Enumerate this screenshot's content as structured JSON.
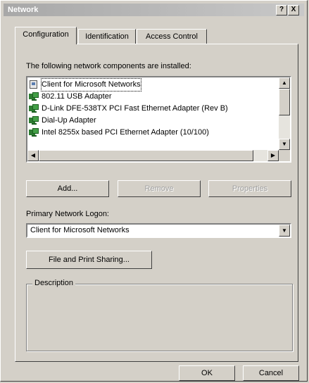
{
  "window": {
    "title": "Network",
    "help_button": "?",
    "close_button": "X"
  },
  "tabs": [
    {
      "label": "Configuration",
      "active": true
    },
    {
      "label": "Identification",
      "active": false
    },
    {
      "label": "Access Control",
      "active": false
    }
  ],
  "components": {
    "heading": "The following network components are installed:",
    "items": [
      {
        "label": "Client for Microsoft Networks",
        "icon": "client-icon"
      },
      {
        "label": "802.11 USB Adapter",
        "icon": "network-adapter-icon"
      },
      {
        "label": "D-Link DFE-538TX PCI Fast Ethernet Adapter (Rev B)",
        "icon": "network-adapter-icon"
      },
      {
        "label": "Dial-Up Adapter",
        "icon": "network-adapter-icon"
      },
      {
        "label": "Intel 8255x based PCI Ethernet Adapter (10/100)",
        "icon": "network-adapter-icon"
      }
    ]
  },
  "buttons": {
    "add": "Add...",
    "remove": "Remove",
    "properties": "Properties"
  },
  "logon": {
    "label": "Primary Network Logon:",
    "value": "Client for Microsoft Networks"
  },
  "sharing_button": "File and Print Sharing...",
  "description": {
    "title": "Description",
    "text": ""
  },
  "footer": {
    "ok": "OK",
    "cancel": "Cancel"
  },
  "colors": {
    "face": "#d4d0c8",
    "title_bar": "#a8a8a8"
  }
}
